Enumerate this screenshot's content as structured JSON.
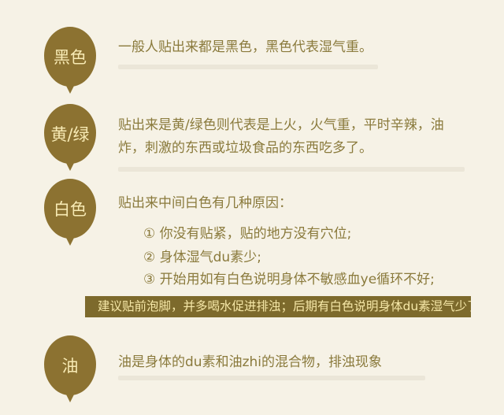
{
  "colors": {
    "bubble": "#8c7231",
    "background": "#f6f2e6",
    "text": "#8a7a3c",
    "banner": "#7d6a2c",
    "banner_text": "#f6e8a8"
  },
  "sections": [
    {
      "label": "黑色",
      "text": "一般人贴出来都是黑色，黑色代表湿气重。"
    },
    {
      "label": "黄/绿",
      "text": "贴出来是黄/绿色则代表是上火，火气重，平时辛辣，油炸，刺激的东西或垃圾食品的东西吃多了。"
    },
    {
      "label": "白色",
      "text": "贴出来中间白色有几种原因：",
      "items": [
        "① 你没有贴紧，贴的地方没有穴位;",
        "② 身体湿气du素少;",
        "③ 开始用如有白色说明身体不敏感血ye循环不好;"
      ]
    },
    {
      "label": "油",
      "text": "油是身体的du素和油zhi的混合物，排浊现象"
    }
  ],
  "banner": "建议贴前泡脚，并多喝水促进排浊；后期有白色说明身体du素湿气少了"
}
